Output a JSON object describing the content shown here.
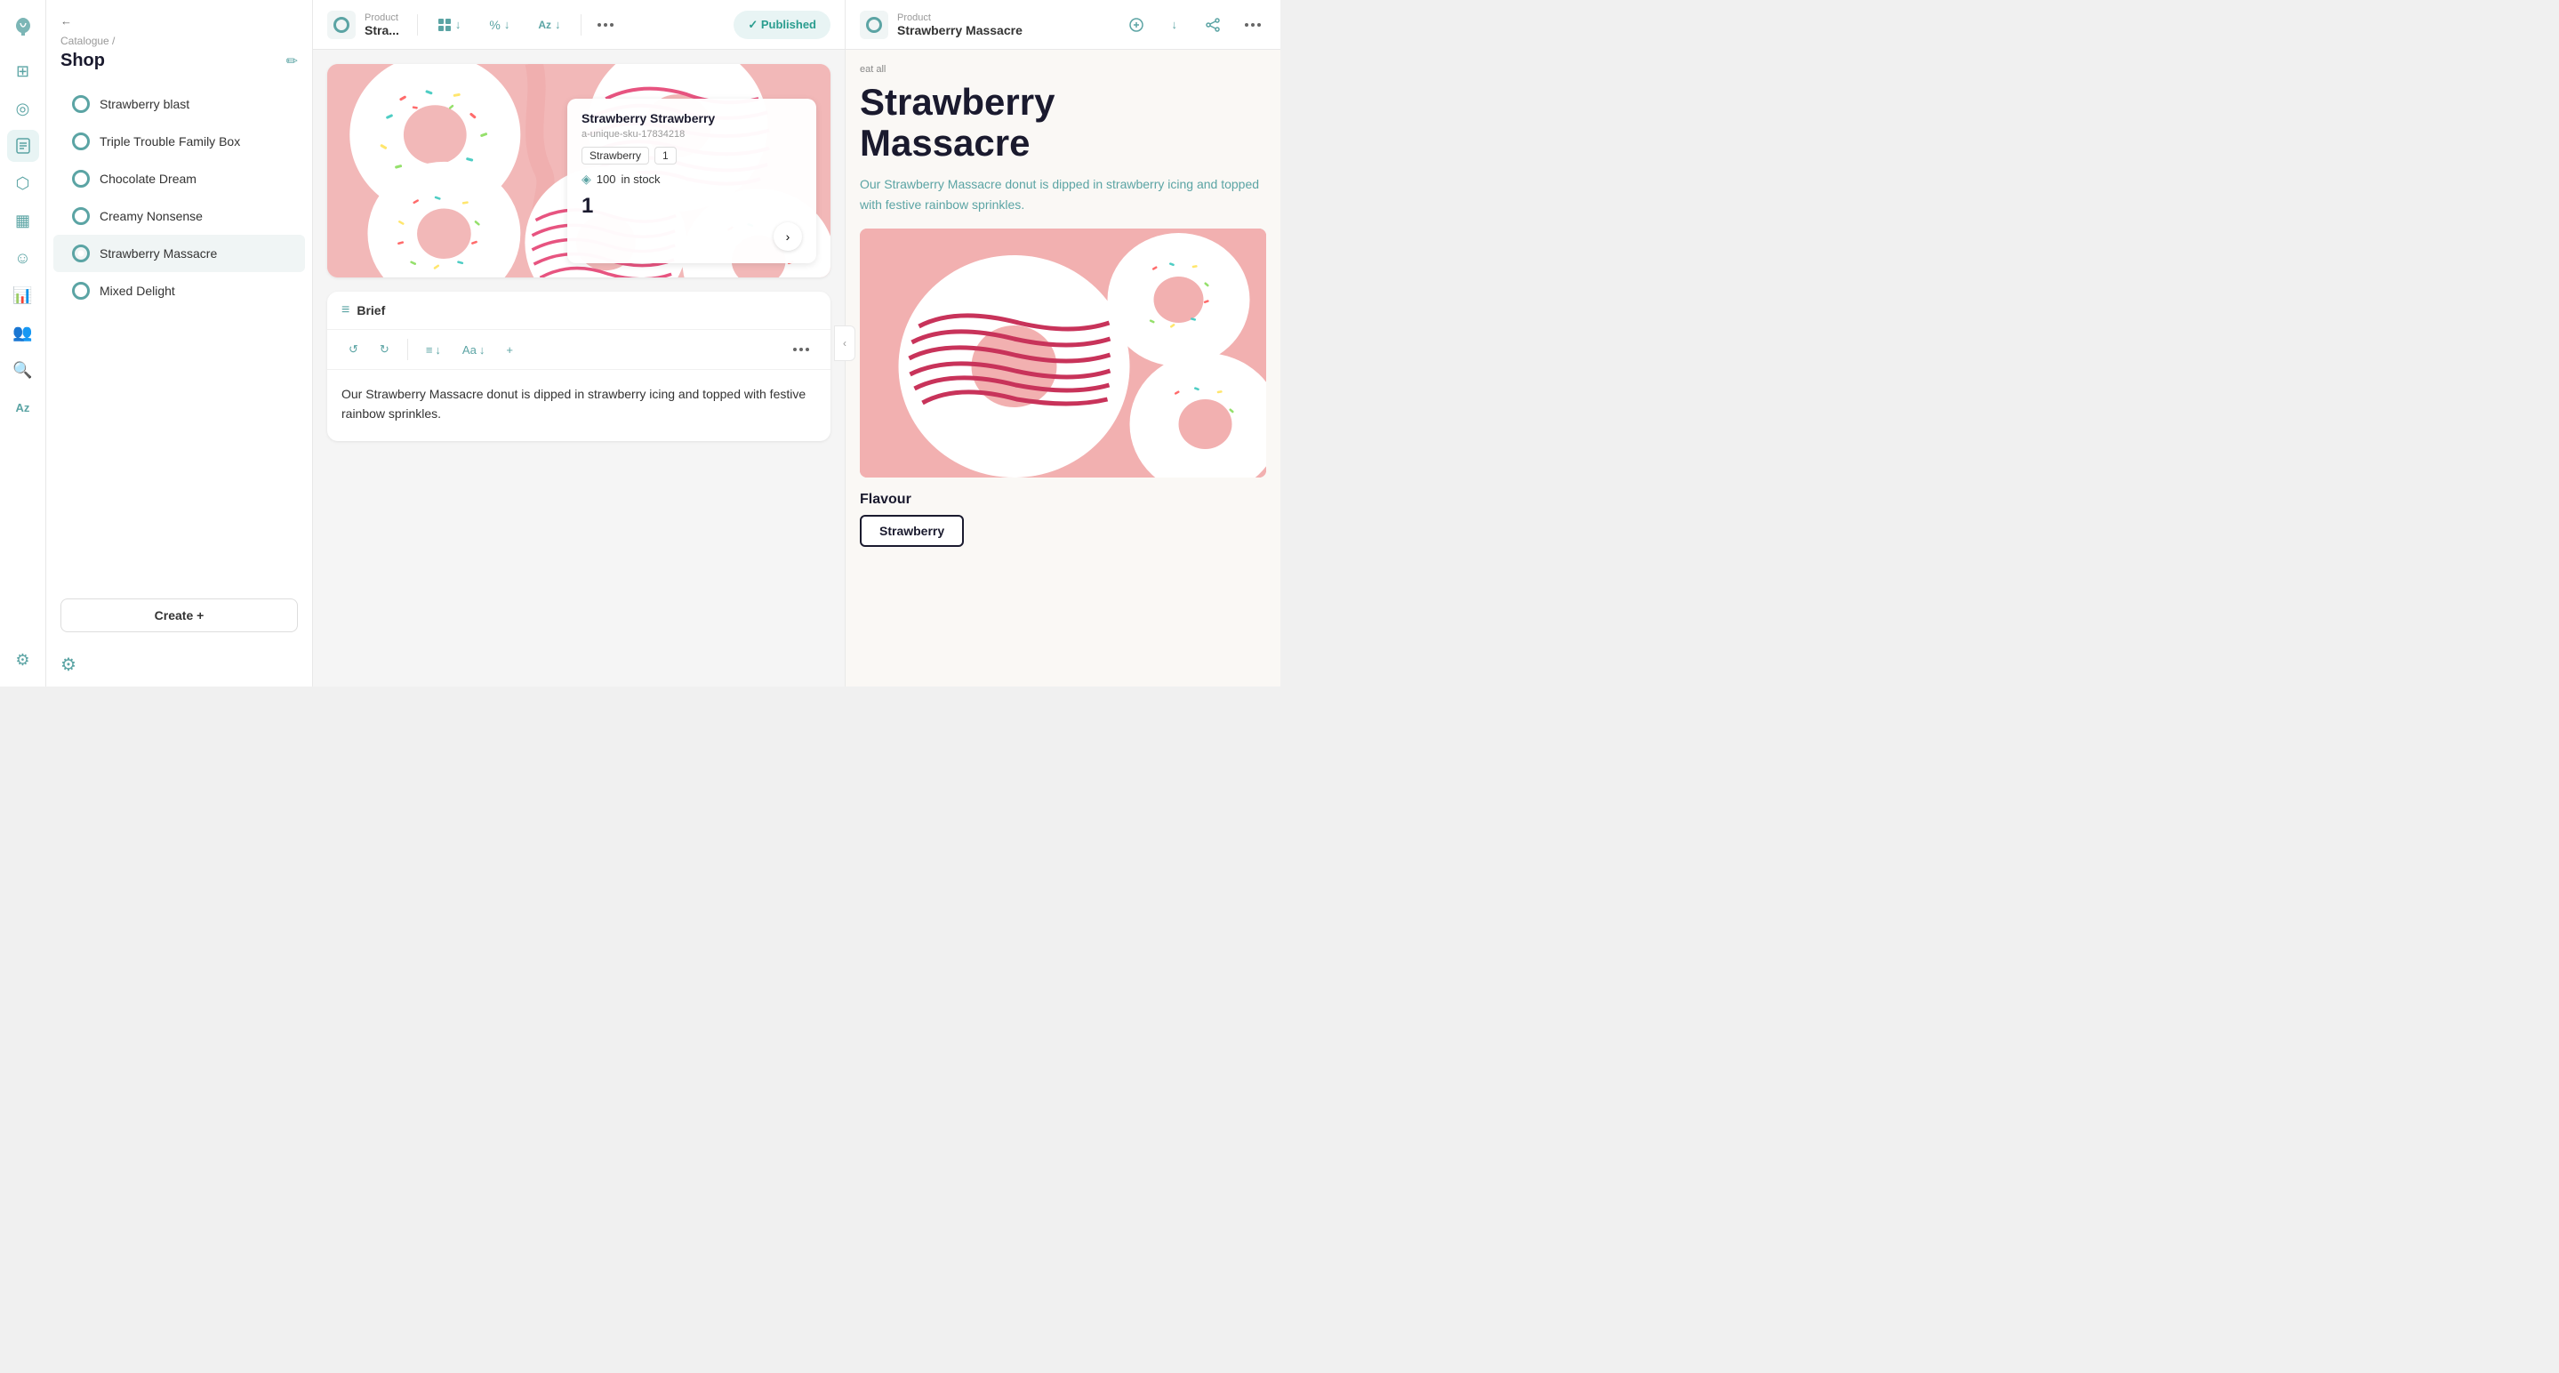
{
  "app": {
    "title": "Shop"
  },
  "sidebar": {
    "breadcrumb": "Catalogue /",
    "shop_title": "Shop",
    "back_label": "back",
    "items": [
      {
        "id": "strawberry-blast",
        "label": "Strawberry blast",
        "active": false
      },
      {
        "id": "triple-trouble",
        "label": "Triple Trouble Family Box",
        "active": false
      },
      {
        "id": "chocolate-dream",
        "label": "Chocolate Dream",
        "active": false
      },
      {
        "id": "creamy-nonsense",
        "label": "Creamy Nonsense",
        "active": false
      },
      {
        "id": "strawberry-massacre",
        "label": "Strawberry Massacre",
        "active": true
      },
      {
        "id": "mixed-delight",
        "label": "Mixed Delight",
        "active": false
      }
    ],
    "create_button": "Create +"
  },
  "toolbar": {
    "product_label": "Product",
    "product_name": "Stra...",
    "published_label": "✓ Published"
  },
  "product_overlay": {
    "title": "Strawberry Strawberry",
    "sku": "a-unique-sku-17834218",
    "tag1": "Strawberry",
    "tag2": "1",
    "stock_count": "100",
    "stock_label": "in stock",
    "number": "1"
  },
  "brief": {
    "label": "Brief",
    "text": "Our Strawberry Massacre donut is dipped in strawberry icing and topped with festive rainbow sprinkles."
  },
  "preview": {
    "product_label": "Product",
    "product_name": "Strawberry Massacre",
    "eaten_text": "eat all",
    "title_line1": "Strawberry",
    "title_line2": "Massacre",
    "description": "Our Strawberry Massacre donut is dipped in strawberry icing and topped with festive rainbow sprinkles.",
    "flavour_label": "Flavour",
    "flavour_value": "Strawberry"
  },
  "icons": {
    "logo": "🍃",
    "grid": "⊞",
    "target": "◎",
    "book": "📖",
    "puzzle": "⬡",
    "grid2": "▦",
    "face": "☺",
    "chart": "📊",
    "users": "👥",
    "search": "🔍",
    "translate": "Aa",
    "settings": "⚙",
    "edit": "✏",
    "undo": "↺",
    "redo": "↻",
    "align": "≡",
    "font": "Aa",
    "plus": "+",
    "arrow_left": "‹",
    "arrow_right": "›",
    "chevron_left": "‹",
    "download1": "↓",
    "download2": "↓",
    "download3": "↓"
  },
  "colors": {
    "teal": "#5ba4a4",
    "dark_blue": "#1a1a2e",
    "pink_bg": "#f9c8c8",
    "preview_bg": "#faf8f5",
    "published_bg": "#e8f4f4",
    "published_text": "#2a9d8f"
  }
}
